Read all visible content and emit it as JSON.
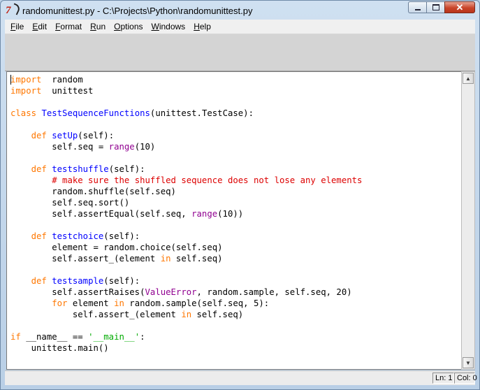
{
  "window": {
    "title": "randomunittest.py - C:\\Projects\\Python\\randomunittest.py",
    "icon": "tk-feather-icon"
  },
  "menu": [
    {
      "key": "F",
      "rest": "ile"
    },
    {
      "key": "E",
      "rest": "dit"
    },
    {
      "key": "F",
      "rest": "ormat"
    },
    {
      "key": "R",
      "rest": "un"
    },
    {
      "key": "O",
      "rest": "ptions"
    },
    {
      "key": "W",
      "rest": "indows"
    },
    {
      "key": "H",
      "rest": "elp"
    }
  ],
  "code_lines": [
    [
      [
        "kw",
        "import"
      ],
      [
        "",
        "  random"
      ]
    ],
    [
      [
        "kw",
        "import"
      ],
      [
        "",
        "  unittest"
      ]
    ],
    [],
    [
      [
        "kw",
        "class"
      ],
      [
        "",
        " "
      ],
      [
        "def",
        "TestSequenceFunctions"
      ],
      [
        "",
        "(unittest.TestCase):"
      ]
    ],
    [],
    [
      [
        "",
        "    "
      ],
      [
        "kw",
        "def"
      ],
      [
        "",
        " "
      ],
      [
        "def",
        "setUp"
      ],
      [
        "",
        "(self):"
      ]
    ],
    [
      [
        "",
        "        self.seq = "
      ],
      [
        "bi",
        "range"
      ],
      [
        "",
        "(10)"
      ]
    ],
    [],
    [
      [
        "",
        "    "
      ],
      [
        "kw",
        "def"
      ],
      [
        "",
        " "
      ],
      [
        "def",
        "testshuffle"
      ],
      [
        "",
        "(self):"
      ]
    ],
    [
      [
        "",
        "        "
      ],
      [
        "cm",
        "# make sure the shuffled sequence does not lose any elements"
      ]
    ],
    [
      [
        "",
        "        random.shuffle(self.seq)"
      ]
    ],
    [
      [
        "",
        "        self.seq.sort()"
      ]
    ],
    [
      [
        "",
        "        self.assertEqual(self.seq, "
      ],
      [
        "bi",
        "range"
      ],
      [
        "",
        "(10))"
      ]
    ],
    [],
    [
      [
        "",
        "    "
      ],
      [
        "kw",
        "def"
      ],
      [
        "",
        " "
      ],
      [
        "def",
        "testchoice"
      ],
      [
        "",
        "(self):"
      ]
    ],
    [
      [
        "",
        "        element = random.choice(self.seq)"
      ]
    ],
    [
      [
        "",
        "        self.assert_(element "
      ],
      [
        "kw",
        "in"
      ],
      [
        "",
        " self.seq)"
      ]
    ],
    [],
    [
      [
        "",
        "    "
      ],
      [
        "kw",
        "def"
      ],
      [
        "",
        " "
      ],
      [
        "def",
        "testsample"
      ],
      [
        "",
        "(self):"
      ]
    ],
    [
      [
        "",
        "        self.assertRaises("
      ],
      [
        "bi",
        "ValueError"
      ],
      [
        "",
        ", random.sample, self.seq, 20)"
      ]
    ],
    [
      [
        "",
        "        "
      ],
      [
        "kw",
        "for"
      ],
      [
        "",
        " element "
      ],
      [
        "kw",
        "in"
      ],
      [
        "",
        " random.sample(self.seq, 5):"
      ]
    ],
    [
      [
        "",
        "            self.assert_(element "
      ],
      [
        "kw",
        "in"
      ],
      [
        "",
        " self.seq)"
      ]
    ],
    [],
    [
      [
        "kw",
        "if"
      ],
      [
        "",
        " __name__ == "
      ],
      [
        "str",
        "'__main__'"
      ],
      [
        "",
        ":"
      ]
    ],
    [
      [
        "",
        "    unittest.main()"
      ]
    ]
  ],
  "status": {
    "line": "Ln: 1",
    "col": "Col: 0"
  },
  "colors": {
    "keyword": "#ff7700",
    "definition": "#0000ff",
    "builtin": "#900090",
    "comment": "#dd0000",
    "string": "#00aa00"
  }
}
